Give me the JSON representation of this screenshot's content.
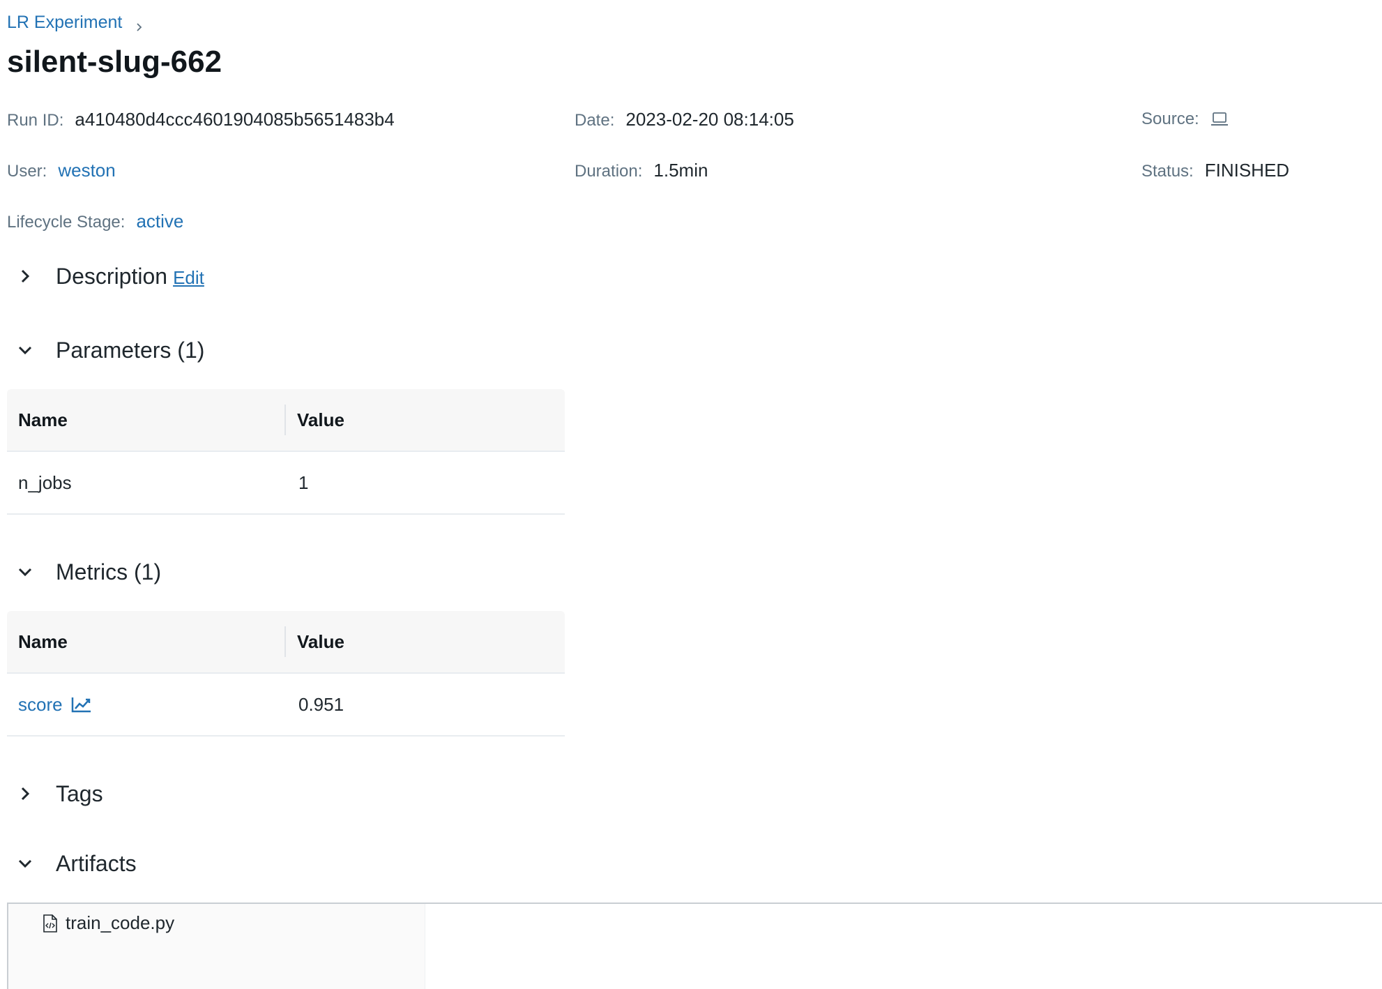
{
  "breadcrumb": {
    "experiment": "LR Experiment"
  },
  "run": {
    "title": "silent-slug-662",
    "run_id_label": "Run ID:",
    "run_id": "a410480d4ccc4601904085b5651483b4",
    "date_label": "Date:",
    "date": "2023-02-20 08:14:05",
    "source_label": "Source:",
    "source_icon": "laptop-icon",
    "user_label": "User:",
    "user": "weston",
    "duration_label": "Duration:",
    "duration": "1.5min",
    "status_label": "Status:",
    "status": "FINISHED",
    "lifecycle_label": "Lifecycle Stage:",
    "lifecycle": "active"
  },
  "sections": {
    "description": {
      "title": "Description",
      "edit": "Edit",
      "expanded": false
    },
    "parameters": {
      "title": "Parameters (1)",
      "expanded": true,
      "columns": [
        "Name",
        "Value"
      ],
      "rows": [
        {
          "name": "n_jobs",
          "value": "1"
        }
      ]
    },
    "metrics": {
      "title": "Metrics (1)",
      "expanded": true,
      "columns": [
        "Name",
        "Value"
      ],
      "rows": [
        {
          "name": "score",
          "value": "0.951",
          "icon": "line-chart-icon"
        }
      ]
    },
    "tags": {
      "title": "Tags",
      "expanded": false
    },
    "artifacts": {
      "title": "Artifacts",
      "expanded": true,
      "files": [
        {
          "name": "train_code.py",
          "icon": "code-file-icon"
        }
      ]
    }
  },
  "colors": {
    "link": "#2272b4",
    "label": "#5f7281",
    "text": "#1f272d",
    "header_bg": "#f7f7f7"
  }
}
